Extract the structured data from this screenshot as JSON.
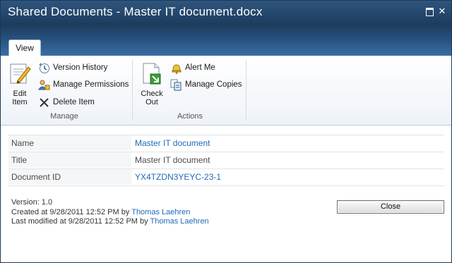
{
  "window": {
    "title": "Shared Documents - Master IT document.docx"
  },
  "ribbon": {
    "tab": "View",
    "manage": {
      "label": "Manage",
      "edit_item_line1": "Edit",
      "edit_item_line2": "Item",
      "version_history": "Version History",
      "manage_permissions": "Manage Permissions",
      "delete_item": "Delete Item"
    },
    "actions": {
      "label": "Actions",
      "check_out_line1": "Check",
      "check_out_line2": "Out",
      "alert_me": "Alert Me",
      "manage_copies": "Manage Copies"
    }
  },
  "properties": [
    {
      "label": "Name",
      "value": "Master IT document"
    },
    {
      "label": "Title",
      "value": "Master IT document"
    },
    {
      "label": "Document ID",
      "value": "YX4TZDN3YEYC-23-1"
    }
  ],
  "footer": {
    "version": "Version: 1.0",
    "created_prefix": "Created at 9/28/2011 12:52 PM by ",
    "created_by": "Thomas Laehren",
    "modified_prefix": "Last modified at 9/28/2011 12:52 PM by ",
    "modified_by": "Thomas Laehren"
  },
  "close_button": "Close",
  "colors": {
    "titlebar": "#1d3c5d",
    "link": "#1f6ab7",
    "ribbon_band": "#2a5888"
  }
}
